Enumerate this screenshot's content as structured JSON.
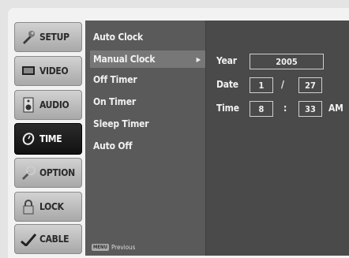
{
  "tabs": [
    {
      "label": "SETUP",
      "icon": "wrench-icon",
      "active": false
    },
    {
      "label": "VIDEO",
      "icon": "monitor-icon",
      "active": false
    },
    {
      "label": "AUDIO",
      "icon": "speaker-icon",
      "active": false
    },
    {
      "label": "TIME",
      "icon": "clock-icon",
      "active": true
    },
    {
      "label": "OPTION",
      "icon": "option-icon",
      "active": false
    },
    {
      "label": "LOCK",
      "icon": "padlock-icon",
      "active": false
    },
    {
      "label": "CABLE",
      "icon": "cable-icon",
      "active": false
    }
  ],
  "menu": {
    "items": [
      {
        "label": "Auto Clock",
        "selected": false
      },
      {
        "label": "Manual Clock",
        "selected": true
      },
      {
        "label": "Off Timer",
        "selected": false
      },
      {
        "label": "On Timer",
        "selected": false
      },
      {
        "label": "Sleep Timer",
        "selected": false
      },
      {
        "label": "Auto Off",
        "selected": false
      }
    ],
    "footer": {
      "key": "MENU",
      "label": "Previous"
    }
  },
  "manual_clock": {
    "year_label": "Year",
    "year": "2005",
    "date_label": "Date",
    "month": "1",
    "date_sep": "/",
    "day": "27",
    "time_label": "Time",
    "hour": "8",
    "time_sep": ":",
    "minute": "33",
    "ampm": "AM"
  }
}
